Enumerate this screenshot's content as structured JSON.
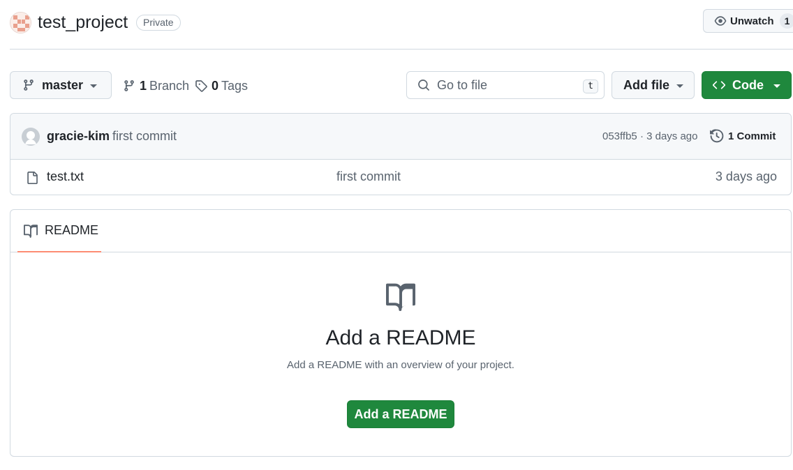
{
  "header": {
    "repo_name": "test_project",
    "visibility_badge": "Private",
    "unwatch_label": "Unwatch",
    "watch_count": "1"
  },
  "toolbar": {
    "branch_name": "master",
    "branches_count": "1",
    "branches_label": "Branch",
    "tags_count": "0",
    "tags_label": "Tags",
    "search_placeholder": "Go to file",
    "search_shortcut": "t",
    "add_file_label": "Add file",
    "code_label": "Code"
  },
  "latest_commit": {
    "author": "gracie-kim",
    "message": "first commit",
    "meta": "053ffb5 · 3 days ago",
    "commit_count_label": "1 Commit"
  },
  "files": [
    {
      "name": "test.txt",
      "commit_message": "first commit",
      "age": "3 days ago"
    }
  ],
  "readme": {
    "tab_label": "README",
    "title": "Add a README",
    "subtitle": "Add a README with an overview of your project.",
    "button_label": "Add a README"
  },
  "colors": {
    "primary_green": "#1f883d",
    "tab_underline": "#fd8c73",
    "border": "#d1d9e0",
    "muted_text": "#59636e"
  },
  "icons": [
    "identicon-avatar",
    "eye-icon",
    "git-branch-icon",
    "tag-icon",
    "search-icon",
    "code-icon",
    "github-avatar",
    "history-icon",
    "file-icon",
    "book-icon"
  ]
}
